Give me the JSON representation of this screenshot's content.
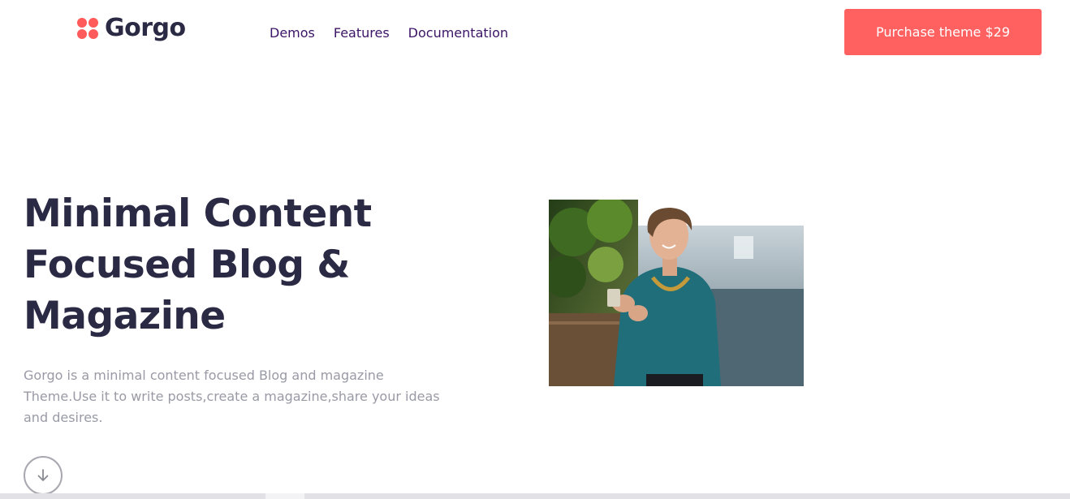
{
  "brand": {
    "name": "Gorgo",
    "logo_icon": "four-dots-logo-icon",
    "logo_color": "#ff5b5b"
  },
  "nav": {
    "items": [
      {
        "label": "Demos"
      },
      {
        "label": "Features"
      },
      {
        "label": "Documentation"
      }
    ],
    "color": "#3b1466"
  },
  "cta": {
    "label": "Purchase theme $29",
    "color": "#ff6161"
  },
  "hero": {
    "title_lines": [
      "Minimal Content",
      "Focused Blog &",
      "Magazine"
    ],
    "description": "Gorgo is a minimal content focused Blog and magazine Theme.Use it to write posts,create a magazine,share your ideas and desires.",
    "scroll_icon": "arrow-down-icon",
    "image": "woman-smiling-with-phone-photo"
  }
}
